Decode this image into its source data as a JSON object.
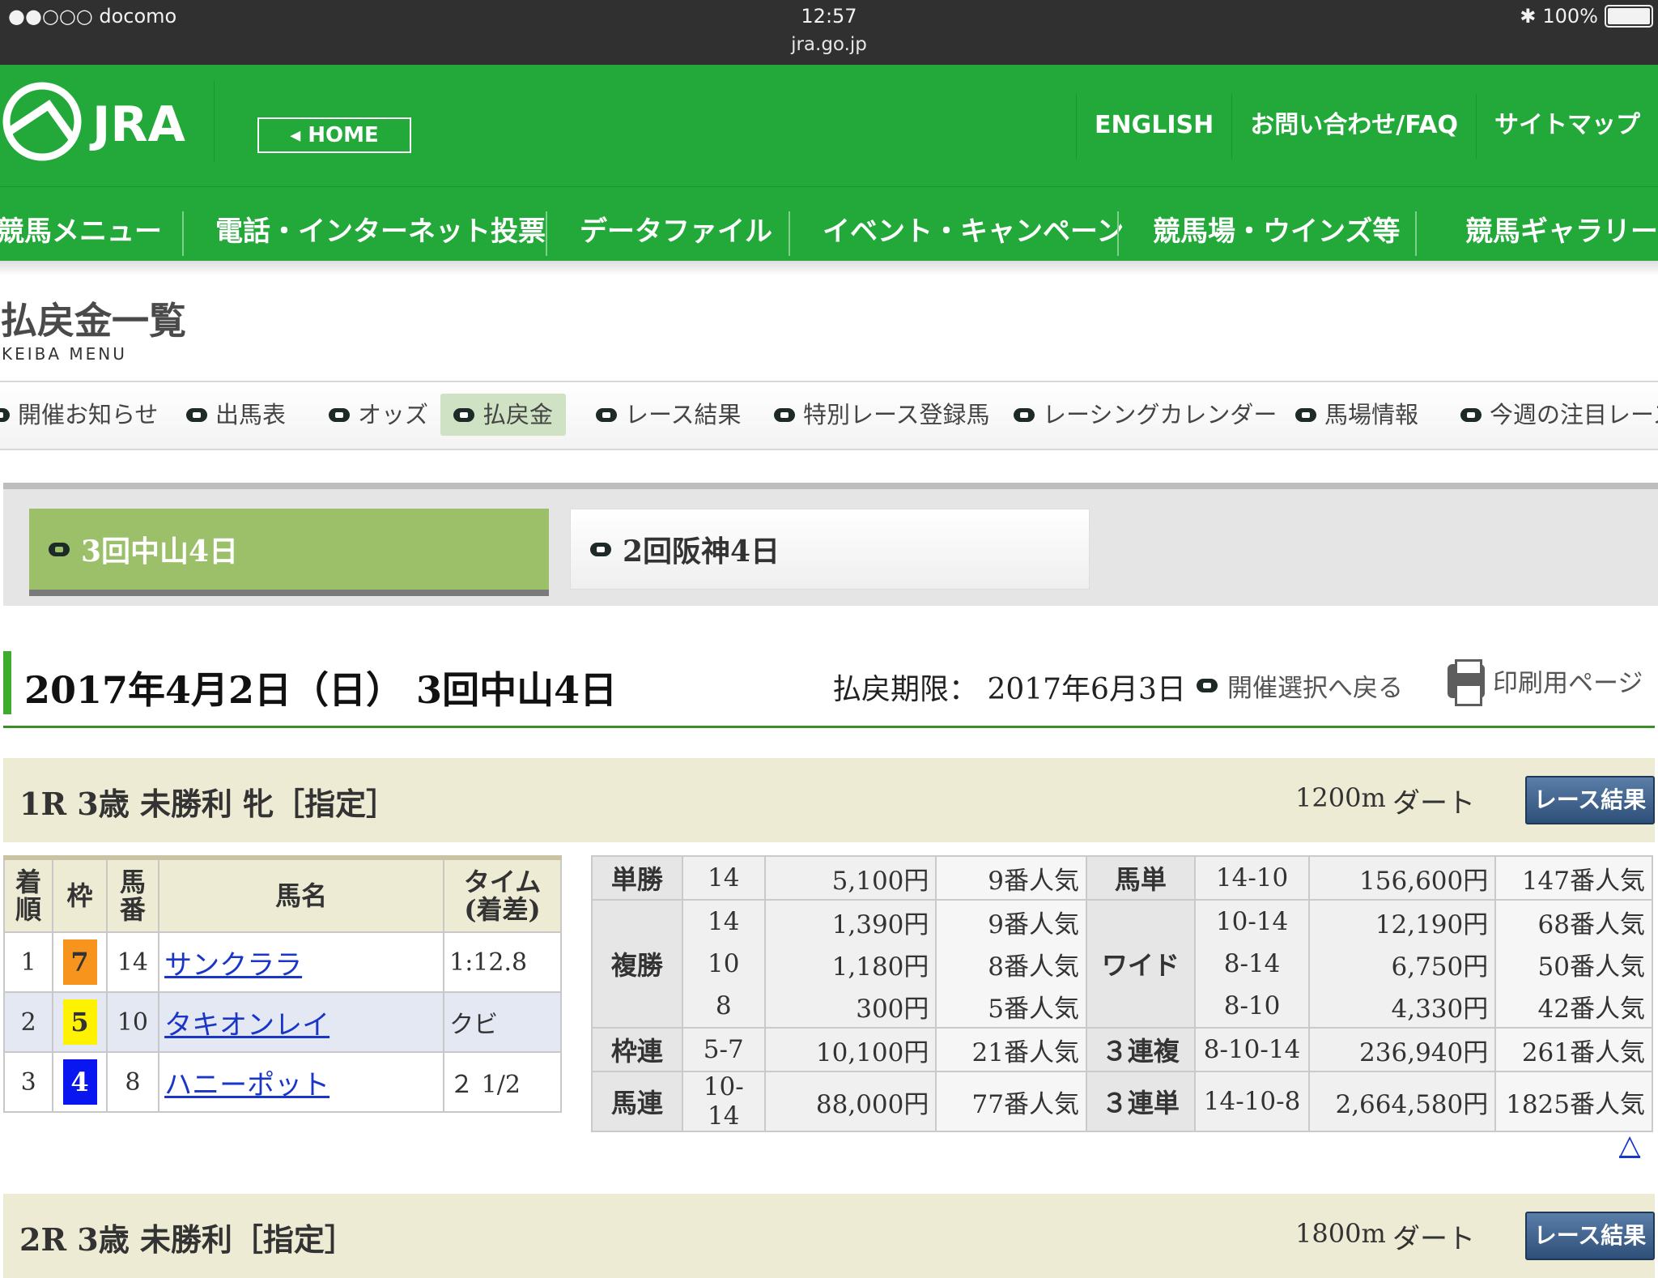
{
  "status": {
    "carrier": "●●○○○ docomo",
    "time": "12:57",
    "url": "jra.go.jp",
    "battery": "100%"
  },
  "header": {
    "logo_text": "JRA",
    "home": "◂ HOME",
    "links": [
      "ENGLISH",
      "お問い合わせ/FAQ",
      "サイトマップ"
    ],
    "nav": [
      "競馬メニュー",
      "電話・インターネット投票",
      "データファイル",
      "イベント・キャンペーン",
      "競馬場・ウインズ等",
      "競馬ギャラリー"
    ]
  },
  "page": {
    "title": "払戻金一覧",
    "subtitle": "KEIBA MENU"
  },
  "subnav": [
    "開催お知らせ",
    "出馬表",
    "オッズ",
    "払戻金",
    "レース結果",
    "特別レース登録馬",
    "レーシングカレンダー",
    "馬場情報",
    "今週の注目レース"
  ],
  "meetings": {
    "active": "3回中山4日",
    "other": "2回阪神4日"
  },
  "date_header": {
    "title": "2017年4月2日（日） 3回中山4日",
    "deadline": "払戻期限： 2017年6月3日",
    "back": "開催選択へ戻る",
    "print": "印刷用ページ"
  },
  "race1": {
    "name": "1R 3歳 未勝利 牝［指定］",
    "distance": "1200m",
    "surface": "ダート",
    "button": "レース結果",
    "headers": {
      "rank": "着順",
      "waku": "枠",
      "num": "馬番",
      "horse": "馬名",
      "time": "タイム(着差)"
    },
    "rows": [
      {
        "rank": "1",
        "waku": "7",
        "waku_color": "#f7941d",
        "num": "14",
        "horse": "サンクララ",
        "time": "1:12.8"
      },
      {
        "rank": "2",
        "waku": "5",
        "waku_color": "#fff200",
        "num": "10",
        "horse": "タキオンレイ",
        "time": "クビ"
      },
      {
        "rank": "3",
        "waku": "4",
        "waku_color": "#0a16f0",
        "num": "8",
        "horse": "ハニーポット",
        "time": "２ 1/2"
      }
    ],
    "payout": {
      "tansho": {
        "label": "単勝",
        "combo": "14",
        "yen": "5,100円",
        "pop": "9番人気"
      },
      "fukusho": {
        "label": "複勝",
        "rows": [
          {
            "combo": "14",
            "yen": "1,390円",
            "pop": "9番人気"
          },
          {
            "combo": "10",
            "yen": "1,180円",
            "pop": "8番人気"
          },
          {
            "combo": "8",
            "yen": "300円",
            "pop": "5番人気"
          }
        ]
      },
      "wakuren": {
        "label": "枠連",
        "combo": "5-7",
        "yen": "10,100円",
        "pop": "21番人気"
      },
      "umaren": {
        "label": "馬連",
        "combo": "10-14",
        "yen": "88,000円",
        "pop": "77番人気"
      },
      "umatan": {
        "label": "馬単",
        "combo": "14-10",
        "yen": "156,600円",
        "pop": "147番人気"
      },
      "wide": {
        "label": "ワイド",
        "rows": [
          {
            "combo": "10-14",
            "yen": "12,190円",
            "pop": "68番人気"
          },
          {
            "combo": "8-14",
            "yen": "6,750円",
            "pop": "50番人気"
          },
          {
            "combo": "8-10",
            "yen": "4,330円",
            "pop": "42番人気"
          }
        ]
      },
      "sanrenpuku": {
        "label": "３連複",
        "combo": "8-10-14",
        "yen": "236,940円",
        "pop": "261番人気"
      },
      "sanrentan": {
        "label": "３連単",
        "combo": "14-10-8",
        "yen": "2,664,580円",
        "pop": "1825番人気"
      }
    }
  },
  "totop": "△",
  "race2": {
    "name": "2R 3歳 未勝利［指定］",
    "distance": "1800m",
    "surface": "ダート",
    "button": "レース結果"
  }
}
